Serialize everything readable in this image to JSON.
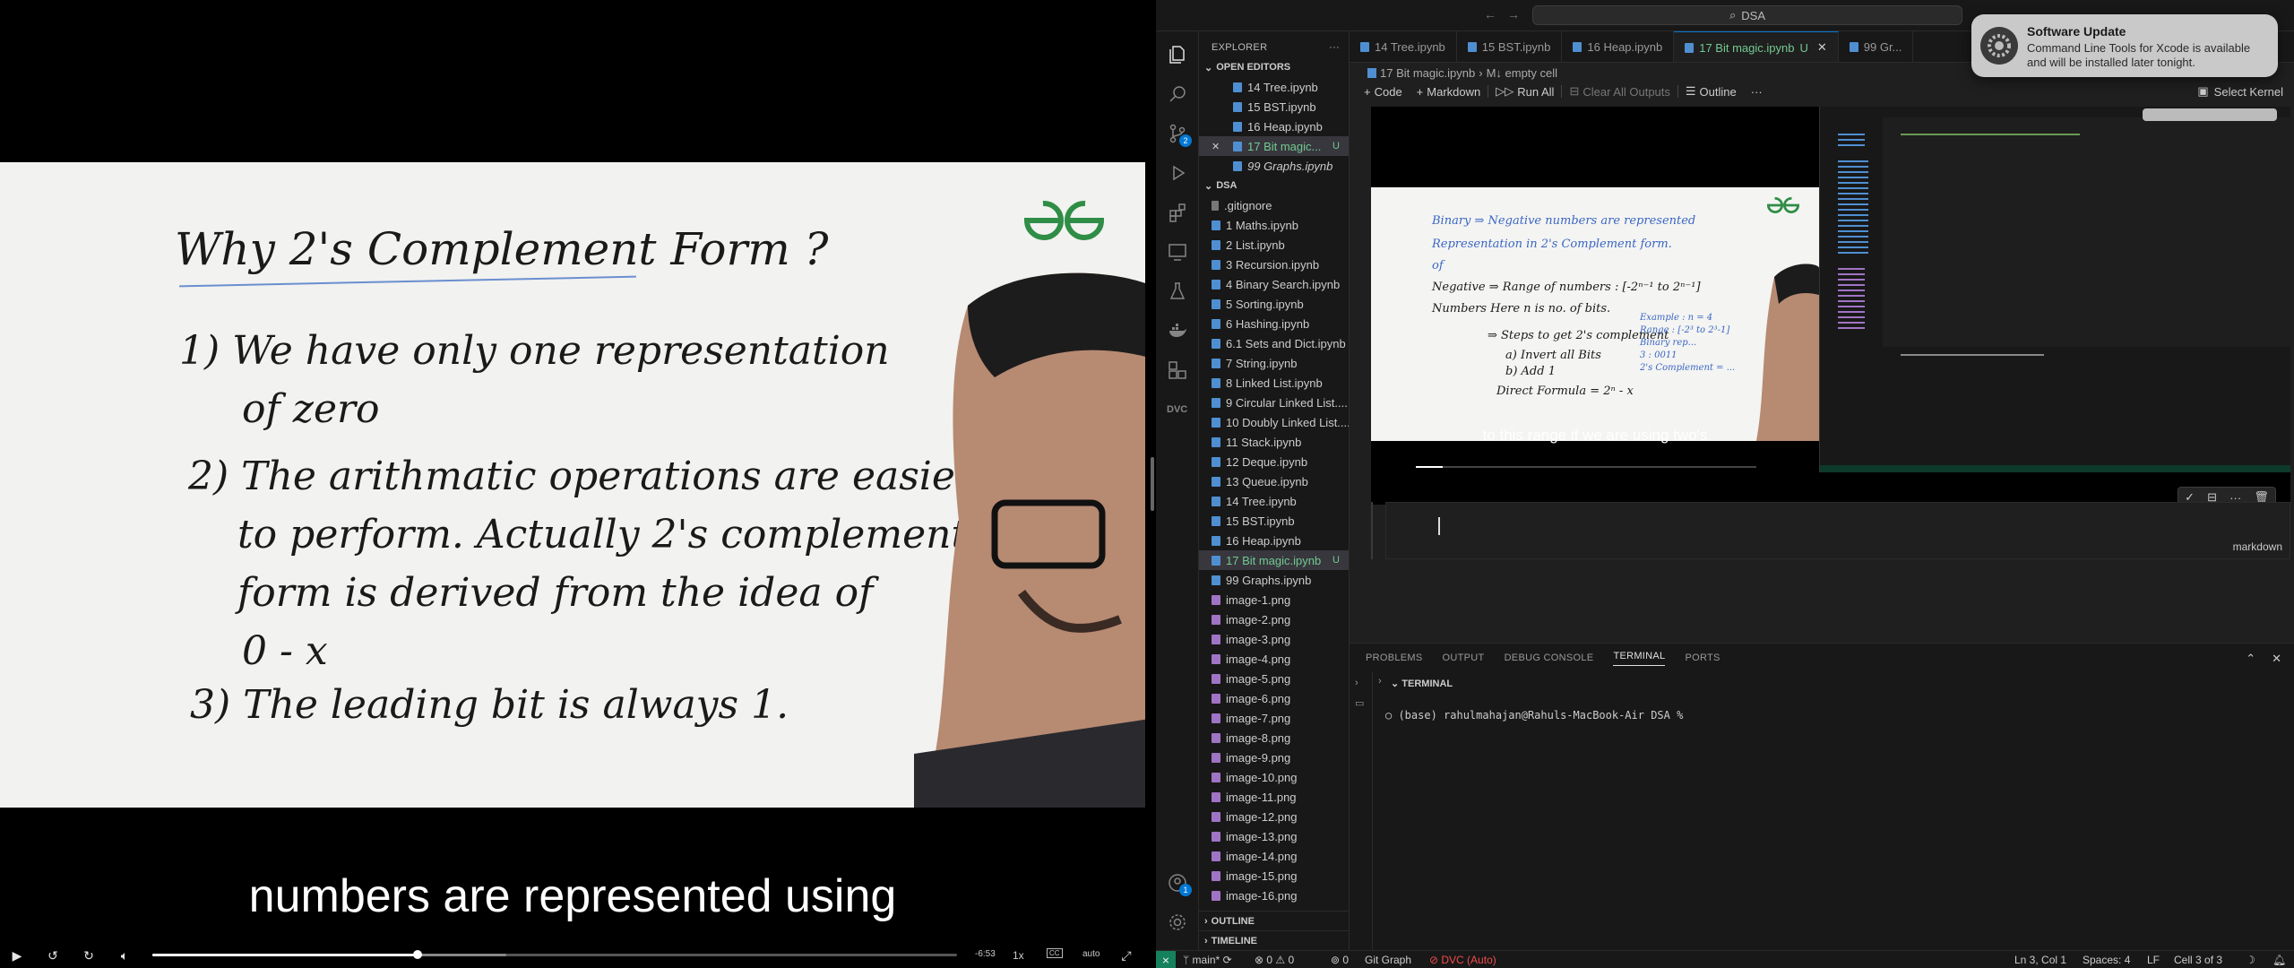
{
  "video": {
    "whiteboard": {
      "title": "Why 2's Complement Form ?",
      "point1_a": "1) We have only one representation",
      "point1_b": "of zero",
      "point2_a": "2) The arithmatic operations are easier",
      "point2_b": "to perform. Actually 2's complement",
      "point2_c": "form is derived from the idea of",
      "point2_d": "0 - x",
      "point3": "3) The leading bit is always 1."
    },
    "caption": "numbers are represented using",
    "progress": 0.33,
    "buffered": 0.44,
    "time_remaining": "-6:53",
    "speed": "1x",
    "cc": "CC",
    "quality": "auto"
  },
  "vscode": {
    "title_search": "DSA",
    "tabs": [
      {
        "label": "14 Tree.ipynb",
        "active": false
      },
      {
        "label": "15 BST.ipynb",
        "active": false
      },
      {
        "label": "16 Heap.ipynb",
        "active": false
      },
      {
        "label": "17 Bit magic.ipynb",
        "active": true,
        "mark": "U"
      },
      {
        "label": "99 Gr...",
        "active": false
      }
    ],
    "breadcrumb": [
      "17 Bit magic.ipynb",
      "M↓ empty cell"
    ],
    "toolbar": {
      "code": "Code",
      "markdown": "Markdown",
      "run_all": "Run All",
      "clear_outputs": "Clear All Outputs",
      "outline": "Outline",
      "more": "···",
      "select_kernel": "Select Kernel"
    },
    "explorer": {
      "header": "EXPLORER",
      "open_editors_header": "OPEN EDITORS",
      "open_editors": [
        {
          "label": "14 Tree.ipynb"
        },
        {
          "label": "15 BST.ipynb"
        },
        {
          "label": "16 Heap.ipynb"
        },
        {
          "label": "17 Bit magic...",
          "selected": true,
          "mark": "U"
        },
        {
          "label": "99 Graphs.ipynb",
          "italic": true
        }
      ],
      "folder": "DSA",
      "files": [
        {
          "label": ".gitignore",
          "type": "git"
        },
        {
          "label": "1 Maths.ipynb",
          "type": "nb"
        },
        {
          "label": "2 List.ipynb",
          "type": "nb"
        },
        {
          "label": "3 Recursion.ipynb",
          "type": "nb"
        },
        {
          "label": "4 Binary Search.ipynb",
          "type": "nb"
        },
        {
          "label": "5 Sorting.ipynb",
          "type": "nb"
        },
        {
          "label": "6 Hashing.ipynb",
          "type": "nb"
        },
        {
          "label": "6.1 Sets and Dict.ipynb",
          "type": "nb"
        },
        {
          "label": "7 String.ipynb",
          "type": "nb"
        },
        {
          "label": "8 Linked List.ipynb",
          "type": "nb"
        },
        {
          "label": "9 Circular Linked List....",
          "type": "nb"
        },
        {
          "label": "10 Doubly Linked List....",
          "type": "nb"
        },
        {
          "label": "11 Stack.ipynb",
          "type": "nb"
        },
        {
          "label": "12 Deque.ipynb",
          "type": "nb"
        },
        {
          "label": "13 Queue.ipynb",
          "type": "nb"
        },
        {
          "label": "14 Tree.ipynb",
          "type": "nb"
        },
        {
          "label": "15 BST.ipynb",
          "type": "nb"
        },
        {
          "label": "16 Heap.ipynb",
          "type": "nb"
        },
        {
          "label": "17 Bit magic.ipynb",
          "type": "nb",
          "selected": true,
          "mark": "U"
        },
        {
          "label": "99 Graphs.ipynb",
          "type": "nb"
        },
        {
          "label": "image-1.png",
          "type": "png"
        },
        {
          "label": "image-2.png",
          "type": "png"
        },
        {
          "label": "image-3.png",
          "type": "png"
        },
        {
          "label": "image-4.png",
          "type": "png"
        },
        {
          "label": "image-5.png",
          "type": "png"
        },
        {
          "label": "image-6.png",
          "type": "png"
        },
        {
          "label": "image-7.png",
          "type": "png"
        },
        {
          "label": "image-8.png",
          "type": "png"
        },
        {
          "label": "image-9.png",
          "type": "png"
        },
        {
          "label": "image-10.png",
          "type": "png"
        },
        {
          "label": "image-11.png",
          "type": "png"
        },
        {
          "label": "image-12.png",
          "type": "png"
        },
        {
          "label": "image-13.png",
          "type": "png"
        },
        {
          "label": "image-14.png",
          "type": "png"
        },
        {
          "label": "image-15.png",
          "type": "png"
        },
        {
          "label": "image-16.png",
          "type": "png"
        }
      ],
      "outline": "OUTLINE",
      "timeline": "TIMELINE"
    },
    "activity_badges": {
      "source_control": "2",
      "accounts": "1"
    },
    "embedded_output": {
      "lines": [
        "Binary  ⇒ Negative numbers are represented",
        "Representation   in 2's Complement form.",
        "of",
        "Negative  ⇒ Range of numbers : [-2ⁿ⁻¹ to 2ⁿ⁻¹]",
        "Numbers        Here n is no. of bits.",
        "⇒ Steps to get 2's complement",
        "a) Invert all Bits",
        "b) Add 1",
        "Direct Formula = 2ⁿ - x"
      ],
      "example": [
        "Example : n = 4",
        "Range : [-2³ to 2³-1]",
        "Binary rep...",
        "3 : 0011",
        "2's Complement = ..."
      ],
      "caption": "to this range if we are using two's"
    },
    "cell": {
      "language": "markdown"
    },
    "panel": {
      "tabs": [
        {
          "label": "PROBLEMS",
          "active": false
        },
        {
          "label": "OUTPUT",
          "active": false
        },
        {
          "label": "DEBUG CONSOLE",
          "active": false
        },
        {
          "label": "TERMINAL",
          "active": true
        },
        {
          "label": "PORTS",
          "active": false
        }
      ],
      "terminal_header": "TERMINAL",
      "prompt": "○ (base) rahulmahajan@Rahuls-MacBook-Air DSA %"
    },
    "notification": {
      "title": "Software Update",
      "body": "Command Line Tools for Xcode is available and will be installed later tonight."
    },
    "status": {
      "branch": "main*",
      "errors": "0",
      "warnings": "0",
      "ports": "0",
      "git_graph": "Git Graph",
      "dvc": "DVC (Auto)",
      "position": "Ln 3, Col 1",
      "spaces": "Spaces: 4",
      "eol": "LF",
      "cell": "Cell 3 of 3"
    }
  },
  "colors": {
    "accent": "#0078d4",
    "modified": "#73c991",
    "gfg_green": "#2f8d46",
    "status_remote": "#16825d"
  }
}
